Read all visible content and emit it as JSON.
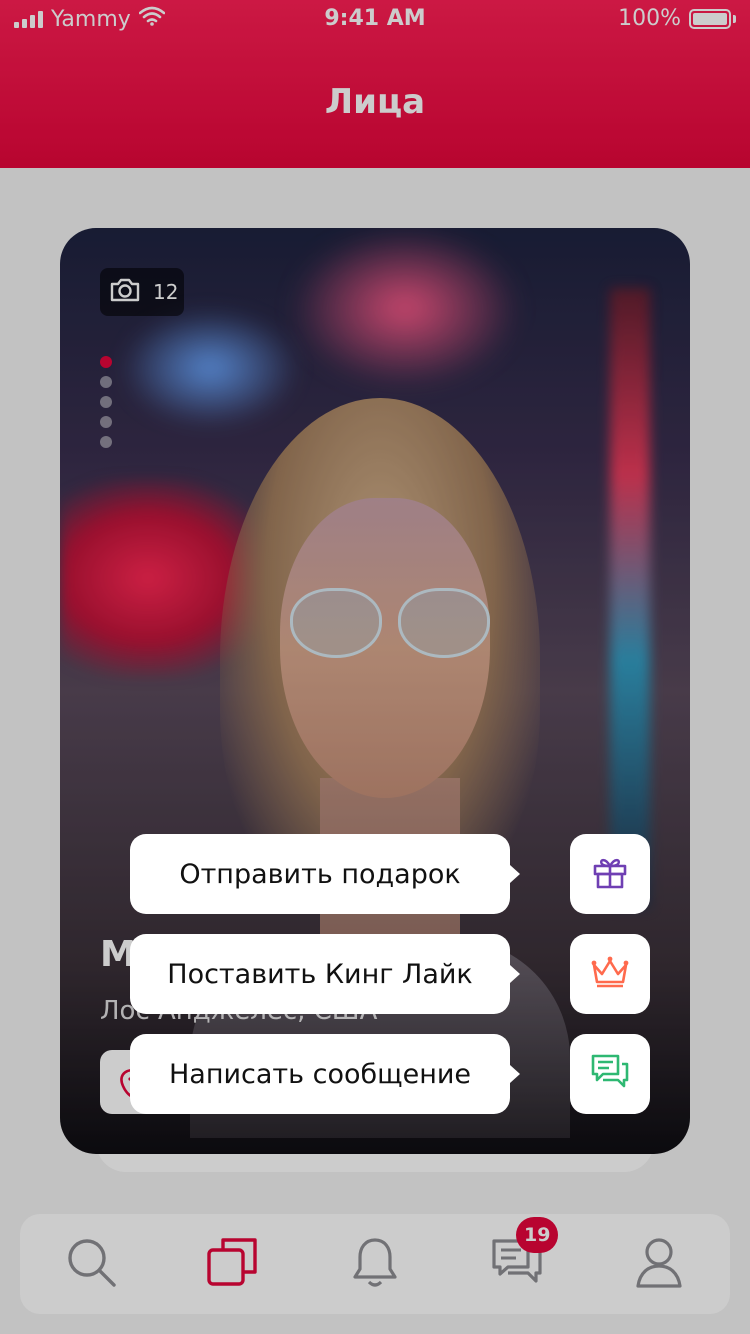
{
  "status_bar": {
    "carrier": "Yammy",
    "time": "9:41 AM",
    "battery": "100%"
  },
  "header": {
    "title": "Лица"
  },
  "profile_card": {
    "photo_count": "12",
    "photo_index": 1,
    "photo_total": 5,
    "name": "М",
    "location": "Лос Анджелес, США"
  },
  "actions": [
    {
      "label": "Отправить подарок",
      "icon": "gift-icon",
      "color": "#6f3fb3"
    },
    {
      "label": "Поставить Кинг Лайк",
      "icon": "crown-icon",
      "color": "#ff6a4d"
    },
    {
      "label": "Написать сообщение",
      "icon": "chat-icon",
      "color": "#2eb872"
    }
  ],
  "tabbar": {
    "items": [
      {
        "icon": "search-icon",
        "active": false
      },
      {
        "icon": "cards-icon",
        "active": true
      },
      {
        "icon": "bell-icon",
        "active": false
      },
      {
        "icon": "messages-icon",
        "active": false,
        "badge": "19"
      },
      {
        "icon": "profile-icon",
        "active": false
      }
    ]
  },
  "colors": {
    "brand": "#e6063c",
    "icon_inactive": "#8e8e93"
  }
}
